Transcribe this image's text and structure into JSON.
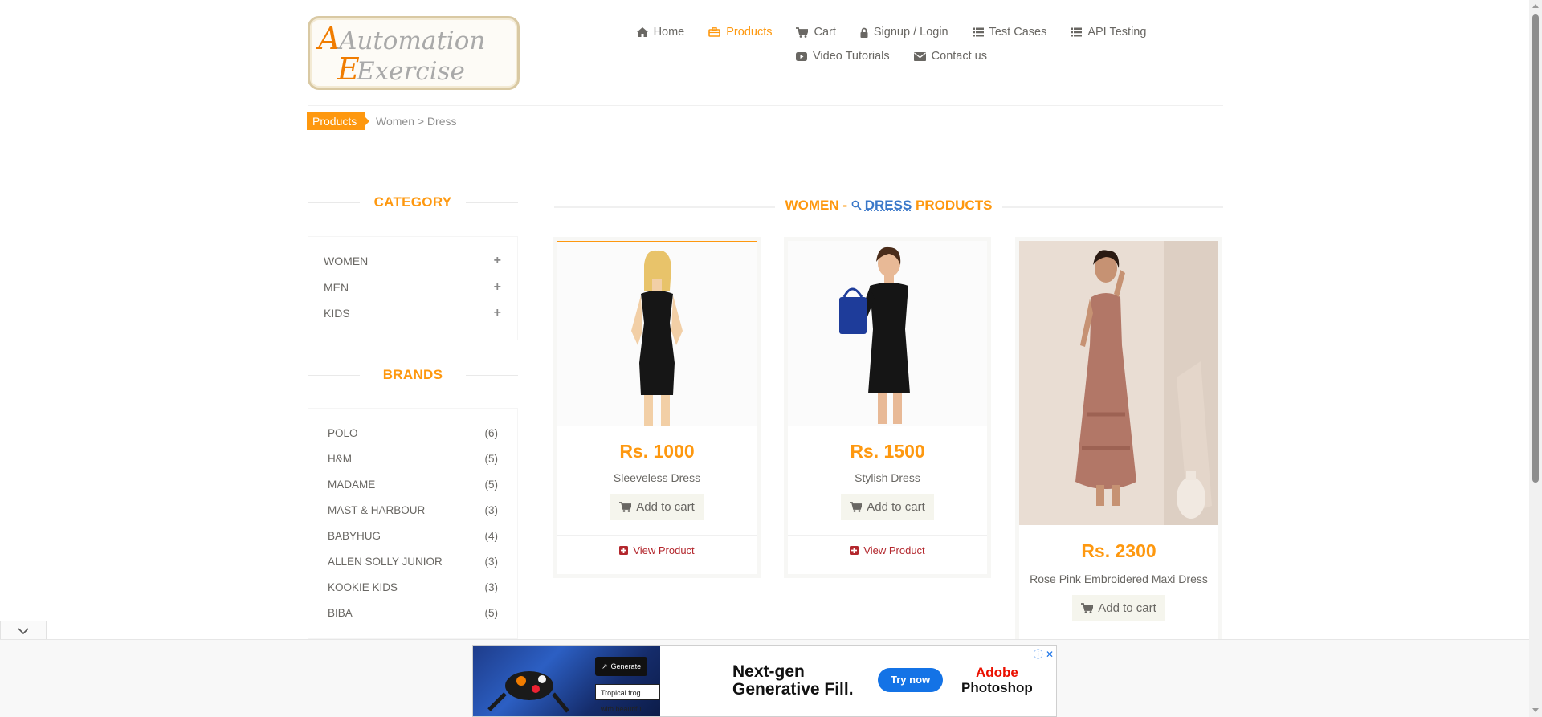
{
  "logo": {
    "line1": "Automation",
    "line2": "Exercise"
  },
  "nav": {
    "row1": [
      {
        "label": "Home",
        "icon": "home-icon"
      },
      {
        "label": "Products",
        "icon": "products-icon",
        "active": true
      },
      {
        "label": "Cart",
        "icon": "cart-icon"
      },
      {
        "label": "Signup / Login",
        "icon": "lock-icon"
      },
      {
        "label": "Test Cases",
        "icon": "list-icon"
      },
      {
        "label": "API Testing",
        "icon": "list-icon"
      }
    ],
    "row2": [
      {
        "label": "Video Tutorials",
        "icon": "youtube-icon"
      },
      {
        "label": "Contact us",
        "icon": "envelope-icon"
      }
    ]
  },
  "breadcrumb": {
    "tag": "Products",
    "path": "Women > Dress"
  },
  "sidebar": {
    "category_title": "CATEGORY",
    "categories": [
      {
        "label": "WOMEN",
        "toggle": "+"
      },
      {
        "label": "MEN",
        "toggle": "+"
      },
      {
        "label": "KIDS",
        "toggle": "+"
      }
    ],
    "brands_title": "BRANDS",
    "brands": [
      {
        "name": "POLO",
        "count": "(6)"
      },
      {
        "name": "H&M",
        "count": "(5)"
      },
      {
        "name": "MADAME",
        "count": "(5)"
      },
      {
        "name": "MAST & HARBOUR",
        "count": "(3)"
      },
      {
        "name": "BABYHUG",
        "count": "(4)"
      },
      {
        "name": "ALLEN SOLLY JUNIOR",
        "count": "(3)"
      },
      {
        "name": "KOOKIE KIDS",
        "count": "(3)"
      },
      {
        "name": "BIBA",
        "count": "(5)"
      }
    ]
  },
  "main": {
    "title_prefix": "WOMEN -",
    "title_link": "DRESS",
    "title_suffix": "PRODUCTS",
    "products": [
      {
        "price": "Rs. 1000",
        "name": "Sleeveless Dress",
        "cart": "Add to cart",
        "view": "View Product"
      },
      {
        "price": "Rs. 1500",
        "name": "Stylish Dress",
        "cart": "Add to cart",
        "view": "View Product"
      },
      {
        "price": "Rs. 2300",
        "name": "Rose Pink Embroidered Maxi Dress",
        "cart": "Add to cart"
      }
    ]
  },
  "ad": {
    "chip": "Generate",
    "chip2": "Tropical frog with beautiful detail...",
    "headline1": "Next-gen",
    "headline2": "Generative Fill.",
    "cta": "Try now",
    "brand1": "Adobe",
    "brand2": "Photoshop"
  },
  "colors": {
    "accent": "#FE980F",
    "text": "#696763",
    "view": "#B3272D"
  }
}
